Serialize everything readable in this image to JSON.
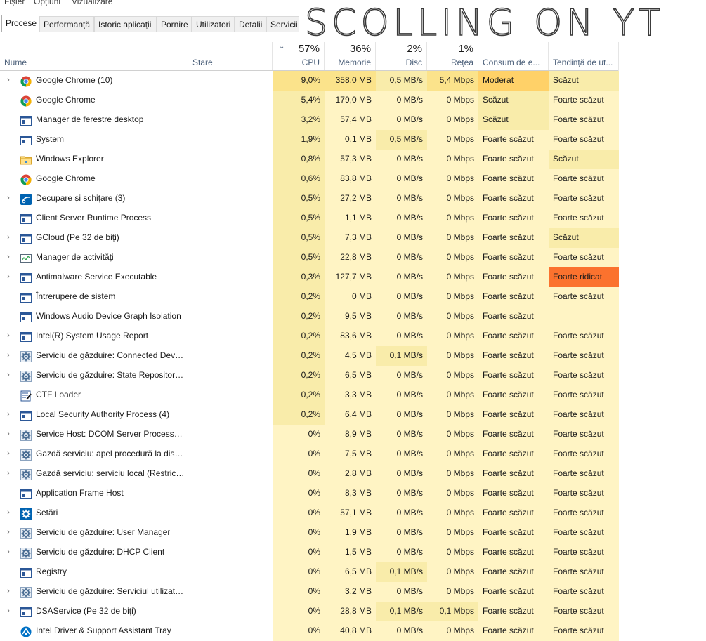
{
  "menu": {
    "file": "Fișier",
    "options": "Opțiuni",
    "view": "Vizualizare"
  },
  "tabs": [
    "Procese",
    "Performanță",
    "Istoric aplicații",
    "Pornire",
    "Utilizatori",
    "Detalii",
    "Servicii"
  ],
  "graffiti_text": "SCOLLING ON YT",
  "columns": {
    "name": "Nume",
    "status": "Stare",
    "cpu": {
      "pct": "57%",
      "label": "CPU"
    },
    "memory": {
      "pct": "36%",
      "label": "Memorie"
    },
    "disk": {
      "pct": "2%",
      "label": "Disc"
    },
    "network": {
      "pct": "1%",
      "label": "Rețea"
    },
    "power": {
      "label": "Consum de e..."
    },
    "trend": {
      "label": "Tendință de ut..."
    }
  },
  "colors": {
    "heat_light": "#fff4c4",
    "heat_mid": "#f9ecaa",
    "heat_high": "#fbe38b",
    "heat_moderate": "#ffd168",
    "heat_very_high": "#fb722e"
  },
  "processes": [
    {
      "name": "Google Chrome (10)",
      "icon": "chrome-icon",
      "expandable": true,
      "status_leaf": false,
      "cpu": "9,0%",
      "mem": "358,0 MB",
      "disk": "0,5 MB/s",
      "net": "5,4 Mbps",
      "power": "Moderat",
      "trend": "Scăzut"
    },
    {
      "name": "Google Chrome",
      "icon": "chrome-icon",
      "expandable": false,
      "status_leaf": false,
      "cpu": "5,4%",
      "mem": "179,0 MB",
      "disk": "0 MB/s",
      "net": "0 Mbps",
      "power": "Scăzut",
      "trend": "Foarte scăzut"
    },
    {
      "name": "Manager de ferestre desktop",
      "icon": "window-app-icon",
      "expandable": false,
      "status_leaf": false,
      "cpu": "3,2%",
      "mem": "57,4 MB",
      "disk": "0 MB/s",
      "net": "0 Mbps",
      "power": "Scăzut",
      "trend": "Foarte scăzut"
    },
    {
      "name": "System",
      "icon": "window-app-icon",
      "expandable": false,
      "status_leaf": false,
      "cpu": "1,9%",
      "mem": "0,1 MB",
      "disk": "0,5 MB/s",
      "net": "0 Mbps",
      "power": "Foarte scăzut",
      "trend": "Foarte scăzut"
    },
    {
      "name": "Windows Explorer",
      "icon": "folder-icon",
      "expandable": false,
      "status_leaf": false,
      "cpu": "0,8%",
      "mem": "57,3 MB",
      "disk": "0 MB/s",
      "net": "0 Mbps",
      "power": "Foarte scăzut",
      "trend": "Scăzut"
    },
    {
      "name": "Google Chrome",
      "icon": "chrome-icon",
      "expandable": false,
      "status_leaf": false,
      "cpu": "0,6%",
      "mem": "83,8 MB",
      "disk": "0 MB/s",
      "net": "0 Mbps",
      "power": "Foarte scăzut",
      "trend": "Foarte scăzut"
    },
    {
      "name": "Decupare și schițare (3)",
      "icon": "snip-sketch-icon",
      "expandable": true,
      "status_leaf": true,
      "cpu": "0,5%",
      "mem": "27,2 MB",
      "disk": "0 MB/s",
      "net": "0 Mbps",
      "power": "Foarte scăzut",
      "trend": "Foarte scăzut"
    },
    {
      "name": "Client Server Runtime Process",
      "icon": "window-app-icon",
      "expandable": false,
      "status_leaf": false,
      "cpu": "0,5%",
      "mem": "1,1 MB",
      "disk": "0 MB/s",
      "net": "0 Mbps",
      "power": "Foarte scăzut",
      "trend": "Foarte scăzut"
    },
    {
      "name": "GCloud (Pe 32 de biți)",
      "icon": "window-app-icon",
      "expandable": true,
      "status_leaf": false,
      "cpu": "0,5%",
      "mem": "7,3 MB",
      "disk": "0 MB/s",
      "net": "0 Mbps",
      "power": "Foarte scăzut",
      "trend": "Scăzut"
    },
    {
      "name": "Manager de activități",
      "icon": "task-manager-icon",
      "expandable": true,
      "status_leaf": false,
      "cpu": "0,5%",
      "mem": "22,8 MB",
      "disk": "0 MB/s",
      "net": "0 Mbps",
      "power": "Foarte scăzut",
      "trend": "Foarte scăzut"
    },
    {
      "name": "Antimalware Service Executable",
      "icon": "window-app-icon",
      "expandable": true,
      "status_leaf": false,
      "cpu": "0,3%",
      "mem": "127,7 MB",
      "disk": "0 MB/s",
      "net": "0 Mbps",
      "power": "Foarte scăzut",
      "trend": "Foarte ridicat"
    },
    {
      "name": "Întrerupere de sistem",
      "icon": "window-app-icon",
      "expandable": false,
      "status_leaf": false,
      "cpu": "0,2%",
      "mem": "0 MB",
      "disk": "0 MB/s",
      "net": "0 Mbps",
      "power": "Foarte scăzut",
      "trend": "Foarte scăzut"
    },
    {
      "name": "Windows Audio Device Graph Isolation",
      "icon": "window-app-icon",
      "expandable": false,
      "status_leaf": false,
      "cpu": "0,2%",
      "mem": "9,5 MB",
      "disk": "0 MB/s",
      "net": "0 Mbps",
      "power": "Foarte scăzut",
      "trend": ""
    },
    {
      "name": "Intel(R) System Usage Report",
      "icon": "window-app-icon",
      "expandable": true,
      "status_leaf": false,
      "cpu": "0,2%",
      "mem": "83,6 MB",
      "disk": "0 MB/s",
      "net": "0 Mbps",
      "power": "Foarte scăzut",
      "trend": "Foarte scăzut"
    },
    {
      "name": "Serviciu de găzduire: Connected Devic...",
      "icon": "gear-service-icon",
      "expandable": true,
      "status_leaf": false,
      "cpu": "0,2%",
      "mem": "4,5 MB",
      "disk": "0,1 MB/s",
      "net": "0 Mbps",
      "power": "Foarte scăzut",
      "trend": "Foarte scăzut"
    },
    {
      "name": "Serviciu de găzduire: State Repository ...",
      "icon": "gear-service-icon",
      "expandable": true,
      "status_leaf": false,
      "cpu": "0,2%",
      "mem": "6,5 MB",
      "disk": "0 MB/s",
      "net": "0 Mbps",
      "power": "Foarte scăzut",
      "trend": "Foarte scăzut"
    },
    {
      "name": "CTF Loader",
      "icon": "ctf-loader-icon",
      "expandable": false,
      "status_leaf": false,
      "cpu": "0,2%",
      "mem": "3,3 MB",
      "disk": "0 MB/s",
      "net": "0 Mbps",
      "power": "Foarte scăzut",
      "trend": "Foarte scăzut"
    },
    {
      "name": "Local Security Authority Process (4)",
      "icon": "window-app-icon",
      "expandable": true,
      "status_leaf": false,
      "cpu": "0,2%",
      "mem": "6,4 MB",
      "disk": "0 MB/s",
      "net": "0 Mbps",
      "power": "Foarte scăzut",
      "trend": "Foarte scăzut"
    },
    {
      "name": "Service Host: DCOM Server Process La...",
      "icon": "gear-service-icon",
      "expandable": true,
      "status_leaf": false,
      "cpu": "0%",
      "mem": "8,9 MB",
      "disk": "0 MB/s",
      "net": "0 Mbps",
      "power": "Foarte scăzut",
      "trend": "Foarte scăzut"
    },
    {
      "name": "Gazdă serviciu: apel procedură la dista...",
      "icon": "gear-service-icon",
      "expandable": true,
      "status_leaf": false,
      "cpu": "0%",
      "mem": "7,5 MB",
      "disk": "0 MB/s",
      "net": "0 Mbps",
      "power": "Foarte scăzut",
      "trend": "Foarte scăzut"
    },
    {
      "name": "Gazdă serviciu: serviciu local (Restricți...",
      "icon": "gear-service-icon",
      "expandable": true,
      "status_leaf": false,
      "cpu": "0%",
      "mem": "2,8 MB",
      "disk": "0 MB/s",
      "net": "0 Mbps",
      "power": "Foarte scăzut",
      "trend": "Foarte scăzut"
    },
    {
      "name": "Application Frame Host",
      "icon": "window-app-icon",
      "expandable": false,
      "status_leaf": false,
      "cpu": "0%",
      "mem": "8,3 MB",
      "disk": "0 MB/s",
      "net": "0 Mbps",
      "power": "Foarte scăzut",
      "trend": "Foarte scăzut"
    },
    {
      "name": "Setări",
      "icon": "settings-gear-icon",
      "expandable": true,
      "status_leaf": false,
      "cpu": "0%",
      "mem": "57,1 MB",
      "disk": "0 MB/s",
      "net": "0 Mbps",
      "power": "Foarte scăzut",
      "trend": "Foarte scăzut"
    },
    {
      "name": "Serviciu de găzduire: User Manager",
      "icon": "gear-service-icon",
      "expandable": true,
      "status_leaf": false,
      "cpu": "0%",
      "mem": "1,9 MB",
      "disk": "0 MB/s",
      "net": "0 Mbps",
      "power": "Foarte scăzut",
      "trend": "Foarte scăzut"
    },
    {
      "name": "Serviciu de găzduire: DHCP Client",
      "icon": "gear-service-icon",
      "expandable": true,
      "status_leaf": false,
      "cpu": "0%",
      "mem": "1,5 MB",
      "disk": "0 MB/s",
      "net": "0 Mbps",
      "power": "Foarte scăzut",
      "trend": "Foarte scăzut"
    },
    {
      "name": "Registry",
      "icon": "window-app-icon",
      "expandable": false,
      "status_leaf": false,
      "cpu": "0%",
      "mem": "6,5 MB",
      "disk": "0,1 MB/s",
      "net": "0 Mbps",
      "power": "Foarte scăzut",
      "trend": "Foarte scăzut"
    },
    {
      "name": "Serviciu de găzduire: Serviciul utilizato...",
      "icon": "gear-service-icon",
      "expandable": true,
      "status_leaf": false,
      "cpu": "0%",
      "mem": "3,2 MB",
      "disk": "0 MB/s",
      "net": "0 Mbps",
      "power": "Foarte scăzut",
      "trend": "Foarte scăzut"
    },
    {
      "name": "DSAService (Pe 32 de biți)",
      "icon": "window-app-icon",
      "expandable": true,
      "status_leaf": false,
      "cpu": "0%",
      "mem": "28,8 MB",
      "disk": "0,1 MB/s",
      "net": "0,1 Mbps",
      "power": "Foarte scăzut",
      "trend": "Foarte scăzut"
    },
    {
      "name": "Intel Driver & Support Assistant Tray",
      "icon": "intel-dsa-icon",
      "expandable": false,
      "status_leaf": false,
      "cpu": "0%",
      "mem": "40,8 MB",
      "disk": "0 MB/s",
      "net": "0 Mbps",
      "power": "Foarte scăzut",
      "trend": "Foarte scăzut"
    }
  ]
}
